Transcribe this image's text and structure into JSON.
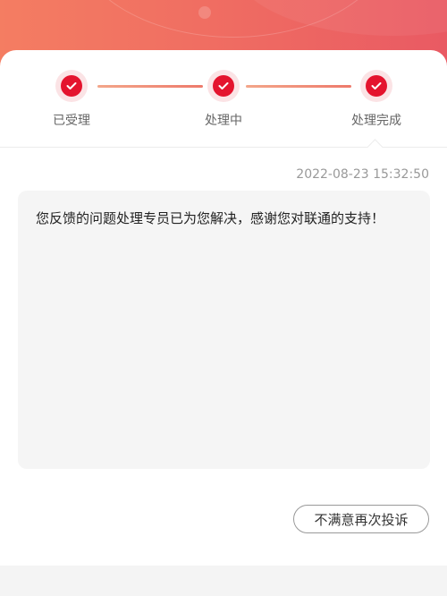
{
  "progress": {
    "steps": [
      {
        "label": "已受理",
        "icon": "check-icon"
      },
      {
        "label": "处理中",
        "icon": "check-icon"
      },
      {
        "label": "处理完成",
        "icon": "check-icon"
      }
    ]
  },
  "message": {
    "timestamp": "2022-08-23 15:32:50",
    "text": "您反馈的问题处理专员已为您解决，感谢您对联通的支持！"
  },
  "actions": {
    "complain_label": "不满意再次投诉"
  },
  "colors": {
    "header_start": "#f47d62",
    "header_end": "#e95a63",
    "check_red": "#e4142e",
    "halo_pink": "#fbe3e5"
  }
}
